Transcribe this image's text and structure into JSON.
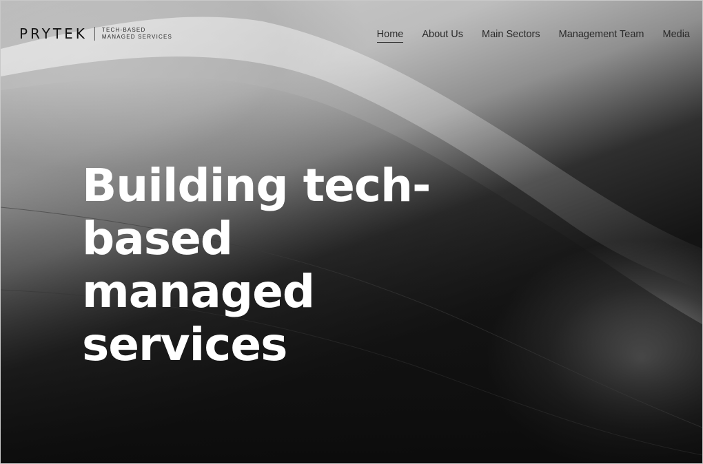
{
  "header": {
    "logo": {
      "wordmark": "PRYTEK",
      "tagline_line1": "TECH-BASED",
      "tagline_line2": "MANAGED SERVICES"
    },
    "nav": [
      {
        "label": "Home",
        "active": true
      },
      {
        "label": "About Us",
        "active": false
      },
      {
        "label": "Main Sectors",
        "active": false
      },
      {
        "label": "Management Team",
        "active": false
      },
      {
        "label": "Media",
        "active": false
      }
    ]
  },
  "hero": {
    "headline": "Building tech-based managed services",
    "background_image": "black-and-white-ocean-wave"
  },
  "colors": {
    "headline_text": "#ffffff",
    "nav_text": "#2a2a2a",
    "logo_text": "#121212"
  }
}
